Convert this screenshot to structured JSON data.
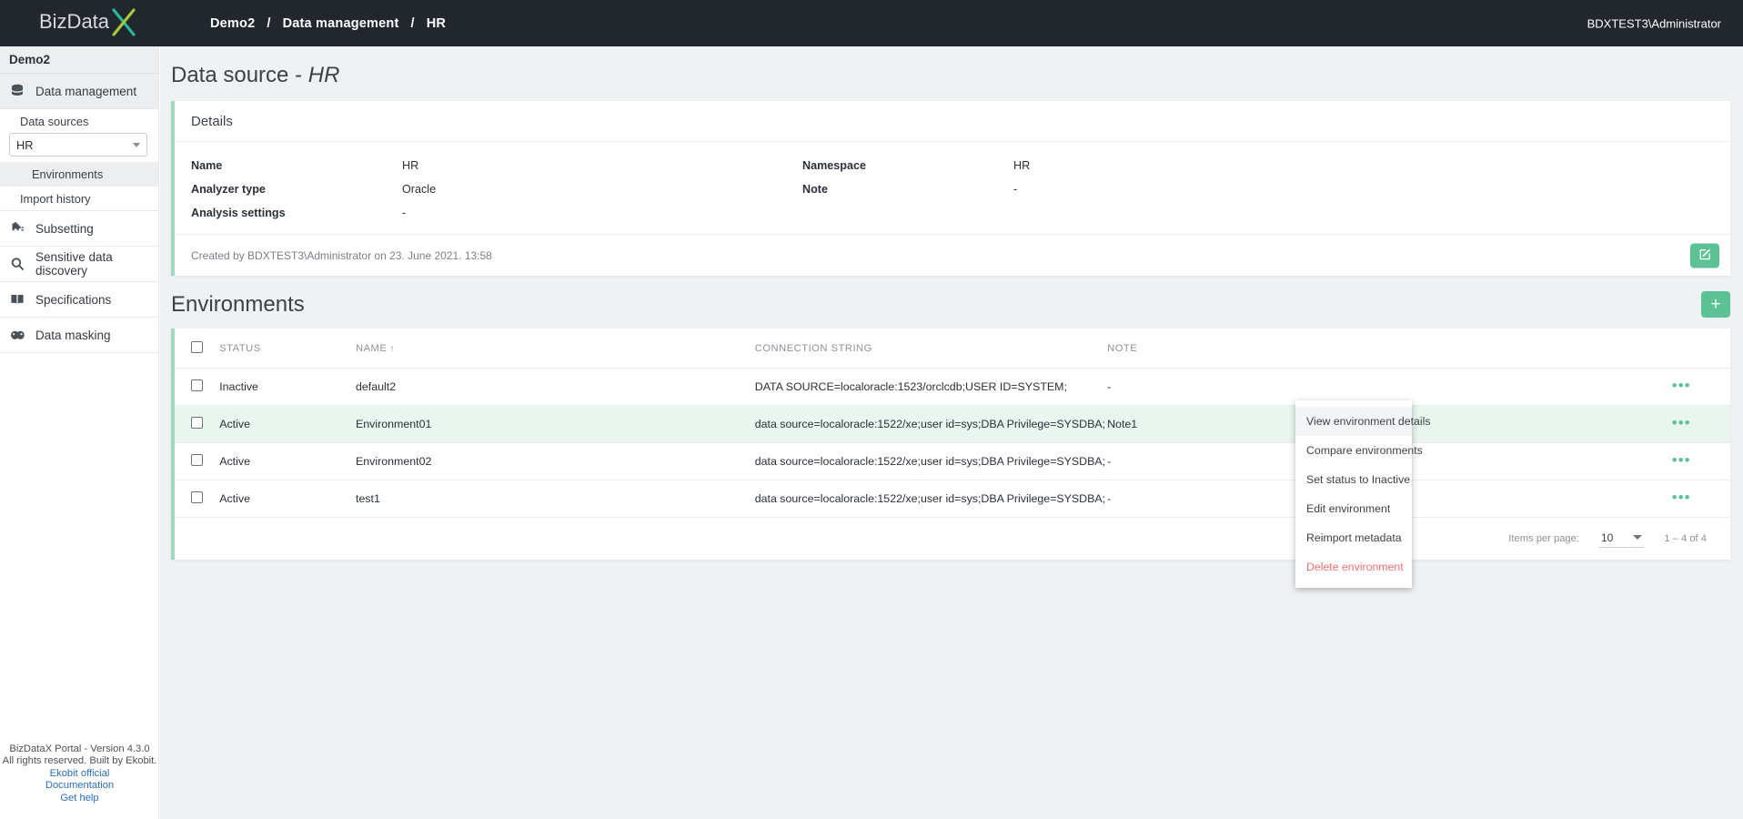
{
  "topbar": {
    "logo_text": "BizDataX",
    "breadcrumb": [
      "Demo2",
      "Data management",
      "HR"
    ],
    "breadcrumb_sep": "/",
    "user": "BDXTEST3\\Administrator"
  },
  "sidebar": {
    "project": "Demo2",
    "group_label": "Data management",
    "data_sources_label": "Data sources",
    "data_source_selected": "HR",
    "environments_label": "Environments",
    "import_history_label": "Import history",
    "items": [
      {
        "label": "Subsetting",
        "icon": "puzzle-icon"
      },
      {
        "label": "Sensitive data discovery",
        "icon": "search-icon"
      },
      {
        "label": "Specifications",
        "icon": "book-icon"
      },
      {
        "label": "Data masking",
        "icon": "masks-icon"
      }
    ],
    "footer": {
      "version": "BizDataX Portal - Version 4.3.0",
      "rights": "All rights reserved. Built by Ekobit.",
      "links": [
        "Ekobit official",
        "Documentation",
        "Get help"
      ]
    }
  },
  "page": {
    "title_prefix": "Data source - ",
    "title_name": "HR"
  },
  "details": {
    "heading": "Details",
    "fields": [
      {
        "label": "Name",
        "value": "HR"
      },
      {
        "label": "Namespace",
        "value": "HR"
      },
      {
        "label": "Analyzer type",
        "value": "Oracle"
      },
      {
        "label": "Note",
        "value": "-"
      },
      {
        "label": "Analysis settings",
        "value": "-"
      }
    ],
    "created_by": "Created by BDXTEST3\\Administrator on 23. June 2021. 13:58",
    "edit_icon": "edit-pencil-icon"
  },
  "environments": {
    "heading": "Environments",
    "add_icon": "plus-icon",
    "columns": [
      "STATUS",
      "NAME",
      "CONNECTION STRING",
      "NOTE"
    ],
    "sorted_column": "NAME",
    "sort_direction": "asc",
    "sort_glyph": "↑",
    "rows": [
      {
        "status": "Inactive",
        "status_state": "inactive",
        "name": "default2",
        "connection": "DATA SOURCE=localoracle:1523/orclcdb;USER ID=SYSTEM;",
        "note": "-",
        "highlighted": false
      },
      {
        "status": "Active",
        "status_state": "active",
        "name": "Environment01",
        "connection": "data source=localoracle:1522/xe;user id=sys;DBA Privilege=SYSDBA;",
        "note": "Note1",
        "highlighted": true
      },
      {
        "status": "Active",
        "status_state": "active",
        "name": "Environment02",
        "connection": "data source=localoracle:1522/xe;user id=sys;DBA Privilege=SYSDBA;",
        "note": "-",
        "highlighted": false
      },
      {
        "status": "Active",
        "status_state": "active",
        "name": "test1",
        "connection": "data source=localoracle:1522/xe;user id=sys;DBA Privilege=SYSDBA;",
        "note": "-",
        "highlighted": false
      }
    ],
    "pagination": {
      "items_per_page_label": "Items per page:",
      "items_per_page_value": "10",
      "range_label": "1 – 4 of 4"
    }
  },
  "context_menu": {
    "items": [
      {
        "label": "View environment details",
        "danger": false
      },
      {
        "label": "Compare environments",
        "danger": false
      },
      {
        "label": "Set status to Inactive",
        "danger": false
      },
      {
        "label": "Edit environment",
        "danger": false
      },
      {
        "label": "Reimport metadata",
        "danger": false
      },
      {
        "label": "Delete environment",
        "danger": true
      }
    ]
  },
  "colors": {
    "accent_green": "#5cc195",
    "active": "#4bb58c",
    "inactive": "#f2726f",
    "topbar": "#22272e",
    "page_bg": "#eff2f3",
    "link": "#2a6ebb"
  }
}
